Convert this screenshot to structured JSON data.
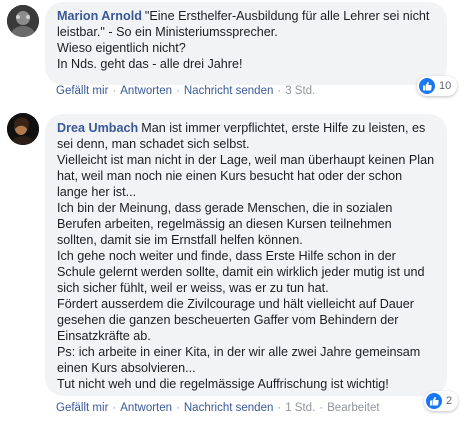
{
  "comments": [
    {
      "author": "Marion Arnold",
      "text": "\"Eine Ersthelfer-Ausbildung für alle Lehrer sei nicht leistbar.\" - So ein Ministeriumssprecher.\nWieso eigentlich nicht?\nIn Nds. geht das - alle drei Jahre!",
      "like_count": "10",
      "actions": {
        "like": "Gefällt mir",
        "reply": "Antworten",
        "message": "Nachricht senden",
        "time": "3 Std."
      }
    },
    {
      "author": "Drea Umbach",
      "text": "Man ist immer verpflichtet, erste Hilfe zu leisten, es sei denn, man schadet sich selbst.\nVielleicht ist man nicht in der Lage, weil man überhaupt keinen Plan hat, weil man noch nie einen Kurs besucht hat oder der schon lange her ist...\nIch bin der Meinung, dass gerade Menschen, die in sozialen Berufen arbeiten, regelmässig an diesen Kursen teilnehmen sollten, damit sie im Ernstfall helfen können.\nIch gehe noch weiter und finde, dass Erste Hilfe schon in der Schule gelernt werden sollte, damit ein wirklich jeder mutig ist und sich sicher fühlt, weil er weiss, was er zu tun hat.\nFördert ausserdem die Zivilcourage und hält vielleicht auf Dauer gesehen die ganzen bescheuerten Gaffer vom Behindern der Einsatzkräfte ab.\nPs: ich arbeite in einer Kita, in der wir alle zwei Jahre gemeinsam einen Kurs absolvieren...\nTut nicht weh und die regelmässige Auffrischung ist wichtig!",
      "like_count": "2",
      "actions": {
        "like": "Gefällt mir",
        "reply": "Antworten",
        "message": "Nachricht senden",
        "time": "1 Std.",
        "edited": "Bearbeitet"
      }
    }
  ],
  "colors": {
    "author": "#385898",
    "bubble": "#f2f3f5",
    "like_blue": "#1877f2",
    "meta": "#606770"
  },
  "icons": {
    "reaction": "thumbs-up-icon"
  }
}
